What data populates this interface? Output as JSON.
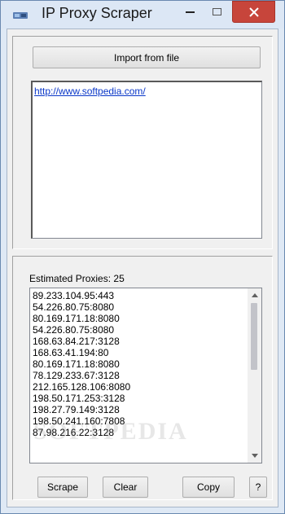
{
  "window": {
    "title": "IP Proxy Scraper"
  },
  "top": {
    "import_label": "Import from file",
    "url_text": "http://www.softpedia.com/"
  },
  "bottom": {
    "estimated_label": "Estimated Proxies:",
    "estimated_count": "25",
    "proxies": [
      "89.233.104.95:443",
      "54.226.80.75:8080",
      "80.169.171.18:8080",
      "54.226.80.75:8080",
      "168.63.84.217:3128",
      "168.63.41.194:80",
      "80.169.171.18:8080",
      "78.129.233.67:3128",
      "212.165.128.106:8080",
      "198.50.171.253:3128",
      "198.27.79.149:3128",
      "198.50.241.160:7808",
      "87.98.216.22:3128"
    ],
    "buttons": {
      "scrape": "Scrape",
      "clear": "Clear",
      "copy": "Copy",
      "help": "?"
    }
  },
  "colors": {
    "close_button": "#c7453b",
    "link": "#0a37c8"
  },
  "icons": [
    "app-icon",
    "minimize-icon",
    "maximize-icon",
    "close-icon",
    "scroll-up-icon",
    "scroll-down-icon"
  ],
  "watermark": "SOFTPEDIA"
}
